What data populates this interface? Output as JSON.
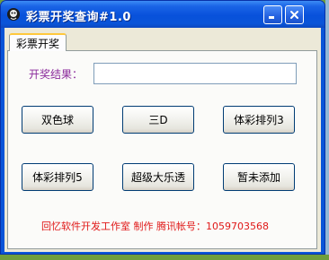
{
  "window": {
    "title": "彩票开奖查询#1.0"
  },
  "tabs": [
    {
      "label": "彩票开奖"
    }
  ],
  "form": {
    "result_label": "开奖结果：",
    "result_value": ""
  },
  "buttons": [
    {
      "label": "双色球"
    },
    {
      "label": "三D"
    },
    {
      "label": "体彩排列3"
    },
    {
      "label": "体彩排列5"
    },
    {
      "label": "超级大乐透"
    },
    {
      "label": "暂未添加"
    }
  ],
  "footer": {
    "credit": "回忆软件开发工作室  制作  腾讯帐号：1059703568"
  },
  "colors": {
    "titlebar": "#0a55d8",
    "label_purple": "#8b2a9b",
    "footer_red": "#e01818",
    "tab_highlight": "#ffc83c"
  },
  "icons": {
    "app": "app-icon",
    "minimize": "minimize-icon",
    "close": "close-icon"
  }
}
